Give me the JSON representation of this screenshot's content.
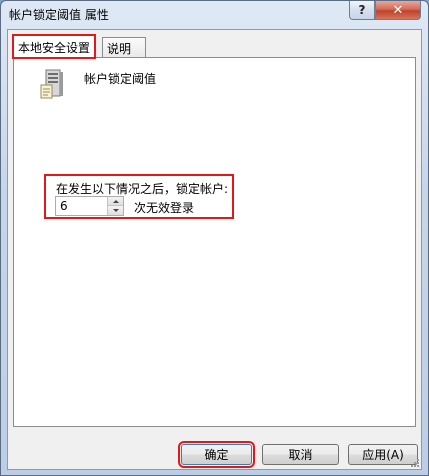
{
  "window": {
    "title": "帐户锁定阈值 属性",
    "help_glyph": "?",
    "close_glyph": "✕"
  },
  "tabs": [
    {
      "label": "本地安全设置",
      "active": true
    },
    {
      "label": "说明",
      "active": false
    }
  ],
  "policy": {
    "icon": "server-policy-icon",
    "name": "帐户锁定阈值"
  },
  "lockout": {
    "label": "在发生以下情况之后，锁定帐户:",
    "value": "6",
    "suffix": "次无效登录"
  },
  "buttons": {
    "ok": "确定",
    "cancel": "取消",
    "apply": "应用(A)"
  },
  "colors": {
    "highlight": "#e01a1a",
    "title_bar": "#c6d6ea",
    "close_button": "#c0432a"
  }
}
